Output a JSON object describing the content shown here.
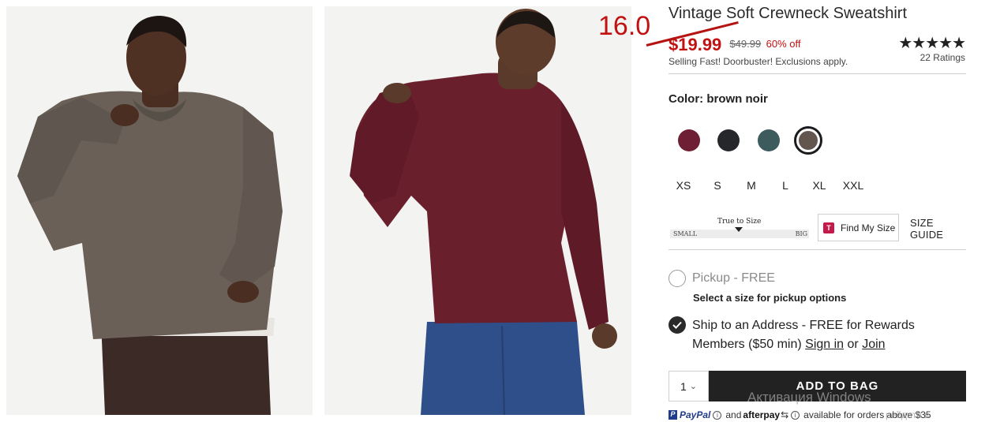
{
  "annotation": {
    "number": "16.0"
  },
  "product": {
    "title": "Vintage Soft Crewneck Sweatshirt",
    "sale_price": "$19.99",
    "original_price": "$49.99",
    "discount": "60% off",
    "promo_text": "Selling Fast! Doorbuster! Exclusions apply.",
    "stars": "★★★★★",
    "rating_count": "22 Ratings"
  },
  "images": [
    {
      "icon": "model-front-brown-sweatshirt",
      "sweater_color": "#6b6058"
    },
    {
      "icon": "model-back-burgundy-sweatshirt",
      "sweater_color": "#6a1f2c"
    }
  ],
  "color": {
    "label": "Color:",
    "selected": "brown noir",
    "swatches": [
      {
        "name": "burgundy",
        "hex": "#6e1f33"
      },
      {
        "name": "black",
        "hex": "#25272b"
      },
      {
        "name": "teal",
        "hex": "#3d5a5d"
      },
      {
        "name": "brown noir",
        "hex": "#62564f",
        "selected": true
      }
    ]
  },
  "sizes": [
    "XS",
    "S",
    "M",
    "L",
    "XL",
    "XXL"
  ],
  "fit": {
    "title": "True to Size",
    "small": "SMALL",
    "big": "BIG",
    "find_my_size": "Find My Size",
    "logo_letter": "T",
    "size_guide": "SIZE GUIDE"
  },
  "fulfillment": {
    "pickup_label": "Pickup - FREE",
    "pickup_hint": "Select a size for pickup options",
    "ship_text": "Ship to an Address - FREE for Rewards Members ($50 min)",
    "sign_in": "Sign in",
    "or": "or",
    "join": "Join"
  },
  "cart": {
    "quantity": "1",
    "add_to_bag": "ADD TO BAG"
  },
  "payments": {
    "paypal": "PayPal",
    "and": "and",
    "afterpay": "afterpay",
    "afterpay_note": "available for orders above $35"
  },
  "watermark": {
    "line1": "Активация Windows",
    "line2": "рейдите в"
  },
  "colors": {
    "sale_red": "#c21111",
    "button_dark": "#222222"
  }
}
